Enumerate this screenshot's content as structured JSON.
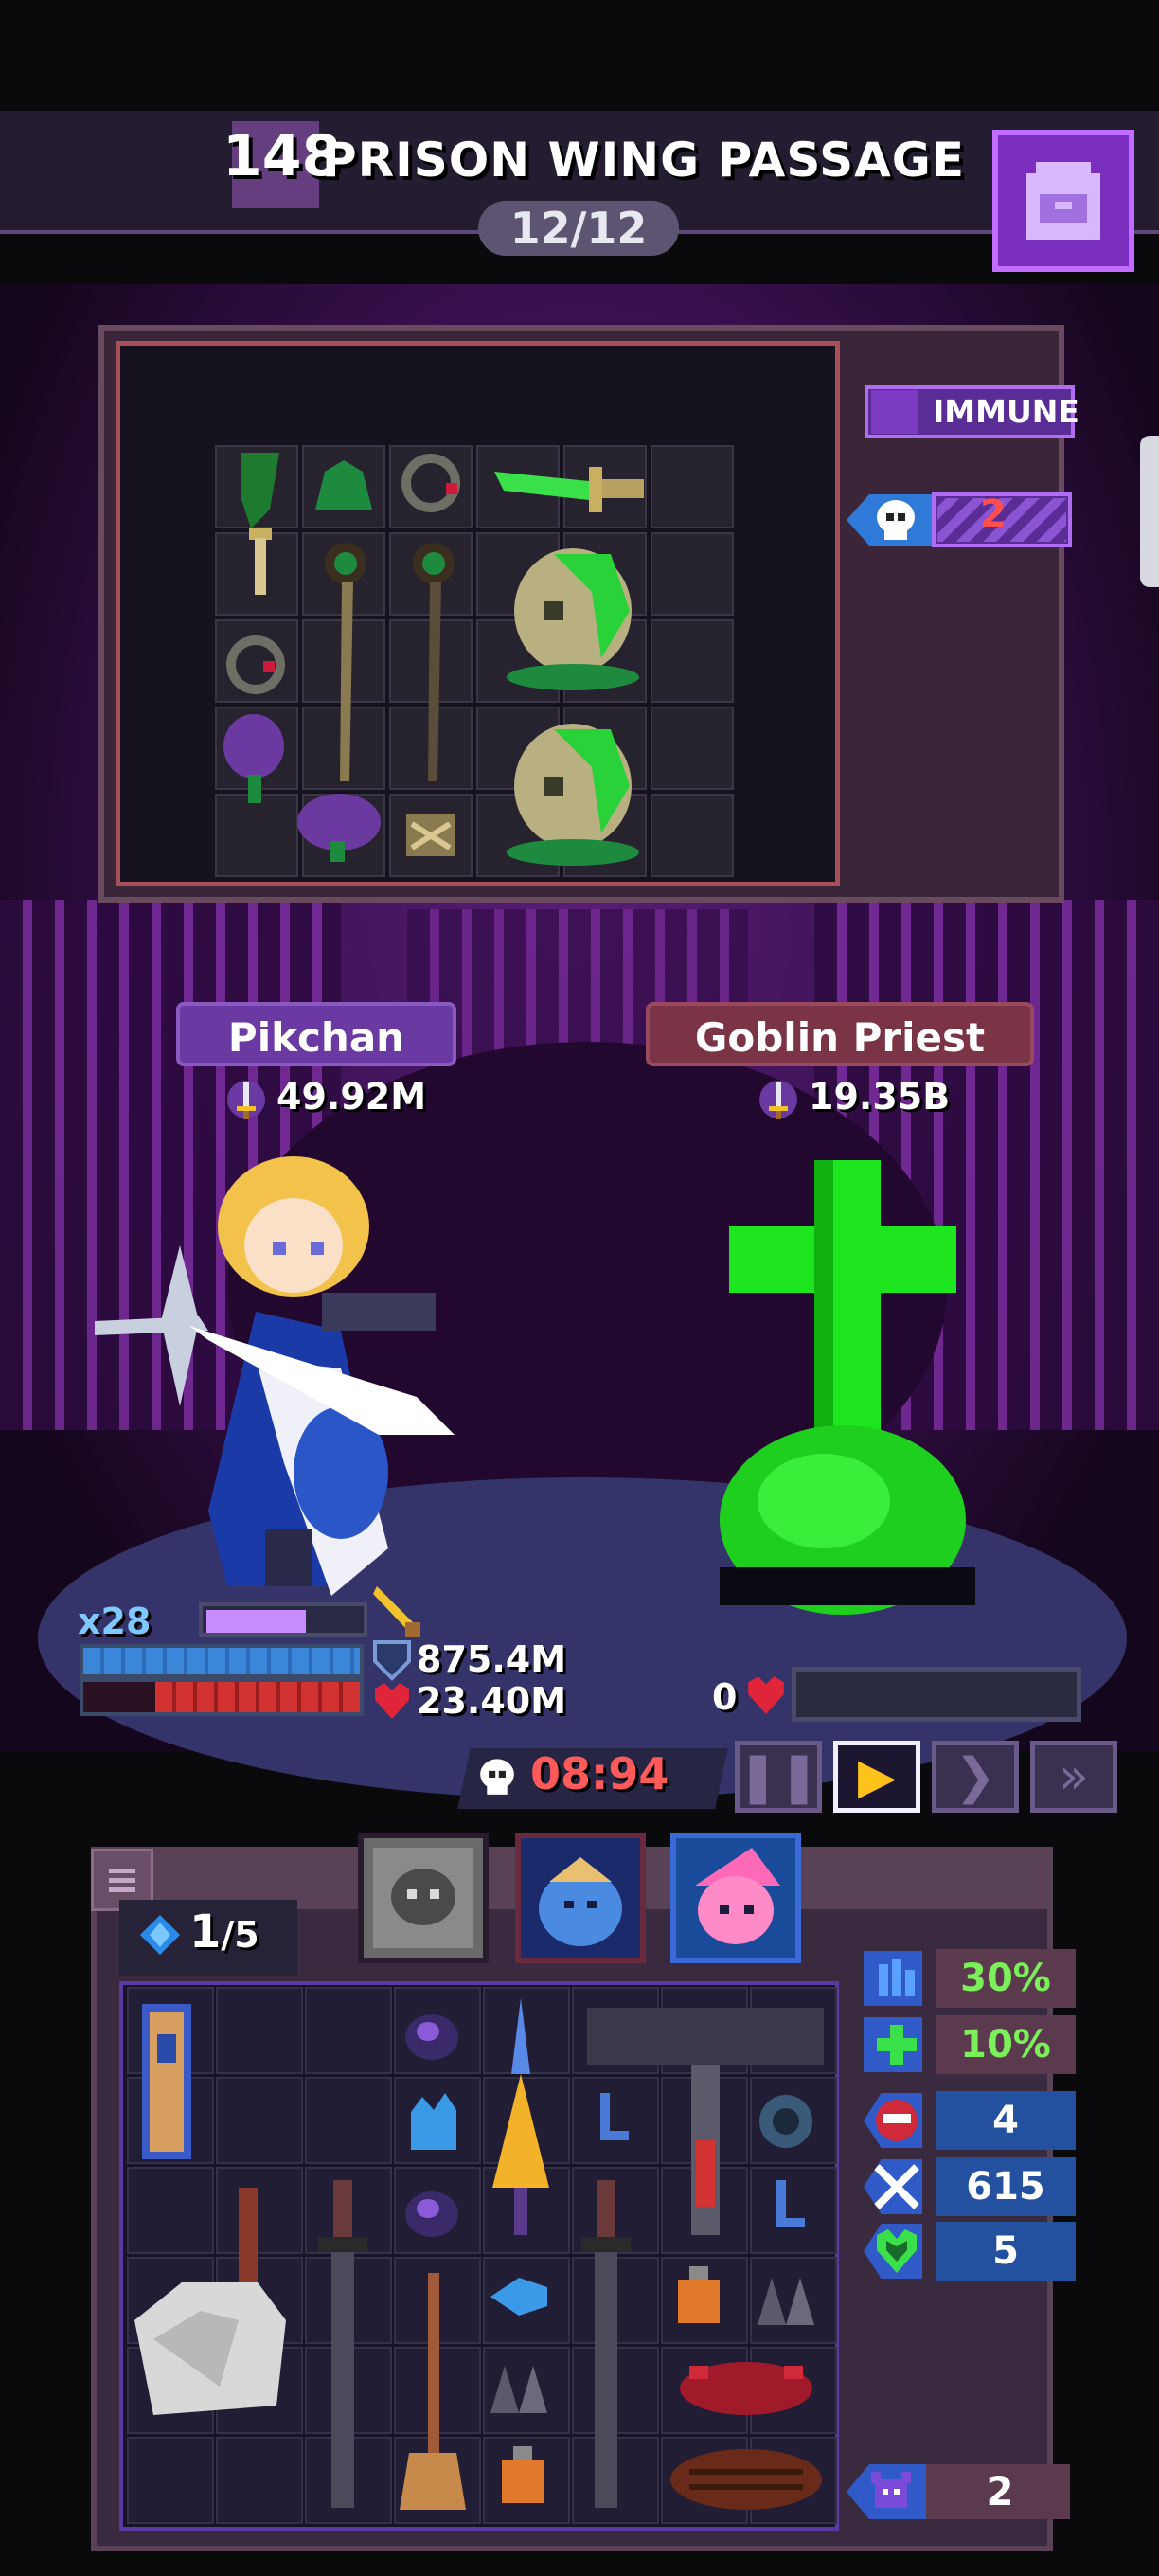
{
  "header": {
    "stage_number": "148",
    "stage_title": "PRISON WING PASSAGE",
    "wave_progress": "12/12",
    "bag_icon": "backpack-icon"
  },
  "enemy_panel": {
    "immune_label": "IMMUNE",
    "skull_count": "2"
  },
  "player": {
    "name": "Pikchan",
    "power": "49.92M",
    "multiplier": "x28",
    "shield": "875.4M",
    "hp": "23.40M",
    "xp_fraction": 0.62,
    "shield_fraction": 1.0,
    "hp_fraction": 0.74
  },
  "enemy": {
    "name": "Goblin Priest",
    "power": "19.35B",
    "hp": "0",
    "hp_fraction": 0
  },
  "battle": {
    "timer": "08:94",
    "speed_buttons": [
      "pause",
      "play",
      "fast",
      "faster"
    ],
    "active_speed": "play"
  },
  "inventory": {
    "gems": "1",
    "gems_max": "/5",
    "stats": [
      {
        "icon": "attack-speed-icon",
        "value": "30%",
        "style": "pct"
      },
      {
        "icon": "heal-plus-icon",
        "value": "10%",
        "style": "pct"
      },
      {
        "icon": "rage-face-icon",
        "value": "4",
        "style": "blue"
      },
      {
        "icon": "crossed-swords-icon",
        "value": "615",
        "style": "blue"
      },
      {
        "icon": "heart-shield-icon",
        "value": "5",
        "style": "blue"
      }
    ],
    "bottom_stat": {
      "icon": "demon-icon",
      "value": "2"
    }
  },
  "colors": {
    "accent_purple": "#7a2fbf",
    "timer_red": "#ff5a5a",
    "percent_green": "#7cf05a",
    "poison_green": "#1ee61e"
  }
}
